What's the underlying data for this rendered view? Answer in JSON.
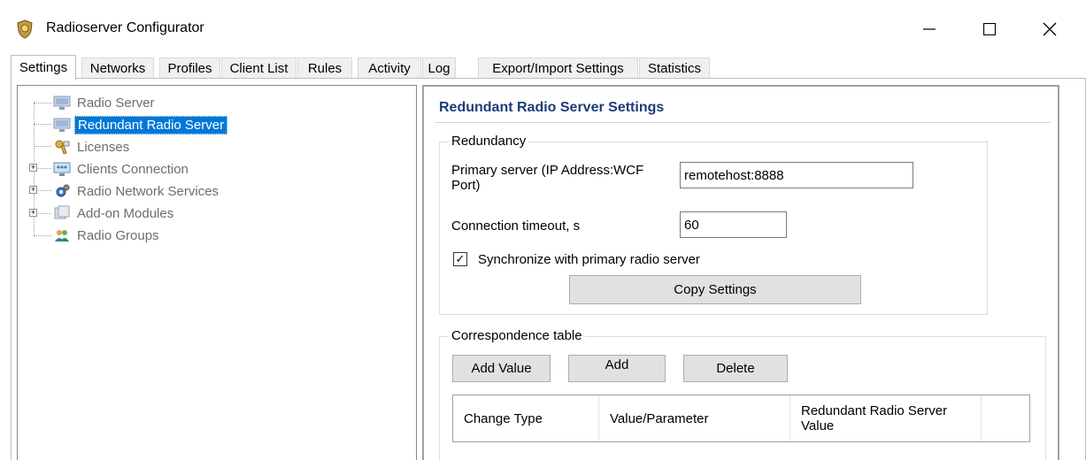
{
  "window": {
    "title": "Radioserver Configurator",
    "minimize_glyph": "—",
    "maximize_glyph": "☐",
    "close_glyph": "✕"
  },
  "tabs": [
    {
      "label": "Settings",
      "active": true
    },
    {
      "label": "Networks"
    },
    {
      "label": "Profiles"
    },
    {
      "label": "Client List"
    },
    {
      "label": "Rules"
    },
    {
      "label": "Activity"
    },
    {
      "label": "Log"
    },
    {
      "label": "Export/Import Settings"
    },
    {
      "label": "Statistics"
    }
  ],
  "tree": {
    "items": [
      {
        "label": "Radio Server",
        "icon": "monitor-icon"
      },
      {
        "label": "Redundant Radio Server",
        "icon": "monitor-icon",
        "selected": true
      },
      {
        "label": "Licenses",
        "icon": "key-icon"
      },
      {
        "label": "Clients Connection",
        "icon": "network-icon",
        "expandable": true
      },
      {
        "label": "Radio Network Services",
        "icon": "gear-icon",
        "expandable": true
      },
      {
        "label": "Add-on Modules",
        "icon": "modules-icon",
        "expandable": true
      },
      {
        "label": "Radio Groups",
        "icon": "users-icon"
      }
    ],
    "expander_glyph": "+"
  },
  "settings": {
    "title": "Redundant Radio Server Settings",
    "redundancy": {
      "caption": "Redundancy",
      "primary_server_label": "Primary server (IP Address:WCF Port)",
      "primary_server_value": "remotehost:8888",
      "timeout_label": "Connection timeout, s",
      "timeout_value": "60",
      "sync_label": "Synchronize with primary radio server",
      "sync_checked": true,
      "check_glyph": "✓",
      "copy_button": "Copy Settings"
    },
    "correspondence": {
      "caption": "Correspondence table",
      "add_value_button": "Add Value",
      "add_button": "Add",
      "delete_button": "Delete",
      "columns": [
        "Change Type",
        "Value/Parameter",
        "Redundant Radio Server Value"
      ]
    }
  }
}
